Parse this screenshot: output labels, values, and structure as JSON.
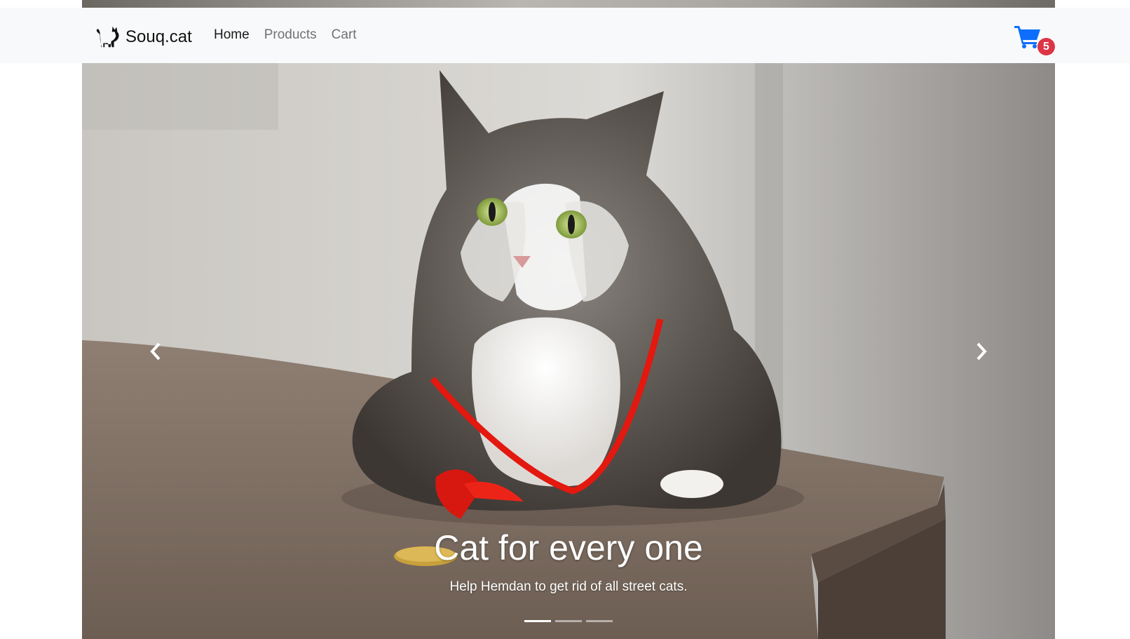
{
  "brand": {
    "name": "Souq.cat",
    "logo_icon": "cat-silhouette-icon"
  },
  "nav": {
    "items": [
      {
        "label": "Home",
        "active": true
      },
      {
        "label": "Products",
        "active": false
      },
      {
        "label": "Cart",
        "active": false
      }
    ]
  },
  "cart": {
    "icon": "shopping-cart-icon",
    "count": "5",
    "icon_color": "#0d6efd",
    "badge_color": "#dc3545"
  },
  "carousel": {
    "slide": {
      "image": "fluffy gray and white cat with red ribbon sitting on a table",
      "title": "Cat for every one",
      "subtitle": "Help Hemdan to get rid of all street cats."
    },
    "prev_icon": "chevron-left-icon",
    "next_icon": "chevron-right-icon",
    "indicators": [
      {
        "active": true
      },
      {
        "active": false
      },
      {
        "active": false
      }
    ]
  }
}
